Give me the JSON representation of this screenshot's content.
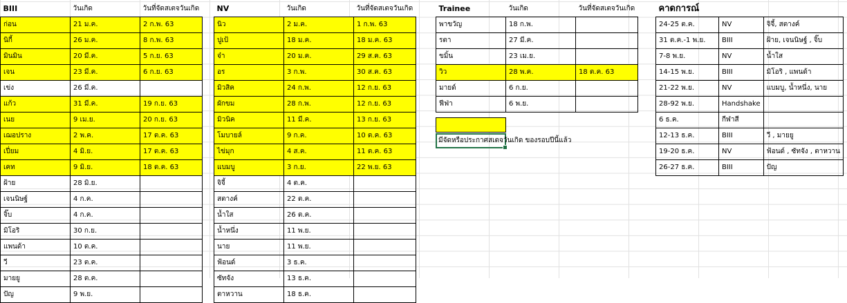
{
  "biii": {
    "headers": [
      "BIII",
      "วันเกิด",
      "วันที่จัดสเตจวันเกิด"
    ],
    "rows": [
      {
        "name": "ก่อน",
        "birthday": "21 ม.ค.",
        "stage": "2 ก.พ. 63",
        "highlight": true
      },
      {
        "name": "นิกี้",
        "birthday": "26 ม.ค.",
        "stage": "8 ก.พ. 63",
        "highlight": true
      },
      {
        "name": "มินมิน",
        "birthday": "20 มี.ค.",
        "stage": "5 ก.ย. 63",
        "highlight": true
      },
      {
        "name": "เจน",
        "birthday": "23 มี.ค.",
        "stage": "6 ก.ย. 63",
        "highlight": true
      },
      {
        "name": "เข่ง",
        "birthday": "26 มี.ค.",
        "stage": "",
        "highlight": false
      },
      {
        "name": "แก้ว",
        "birthday": "31 มี.ค.",
        "stage": "19 ก.ย. 63",
        "highlight": true
      },
      {
        "name": "เนย",
        "birthday": "9 เม.ย.",
        "stage": "20 ก.ย. 63",
        "highlight": true
      },
      {
        "name": "เฌอปราง",
        "birthday": "2 พ.ค.",
        "stage": "17 ต.ค. 63",
        "highlight": true
      },
      {
        "name": "เปี่ยม",
        "birthday": "4 มิ.ย.",
        "stage": "17 ต.ค. 63",
        "highlight": true
      },
      {
        "name": "เคท",
        "birthday": "9 มิ.ย.",
        "stage": "18 ต.ค. 63",
        "highlight": true
      },
      {
        "name": "ฝ้าย",
        "birthday": "28 มิ.ย.",
        "stage": "",
        "highlight": false
      },
      {
        "name": "เจนนิษฐ์",
        "birthday": "4 ก.ค.",
        "stage": "",
        "highlight": false
      },
      {
        "name": "จิ๊บ",
        "birthday": "4 ก.ค.",
        "stage": "",
        "highlight": false
      },
      {
        "name": "มิโอริ",
        "birthday": "30 ก.ย.",
        "stage": "",
        "highlight": false
      },
      {
        "name": "แพนด้า",
        "birthday": "10 ต.ค.",
        "stage": "",
        "highlight": false
      },
      {
        "name": "วี",
        "birthday": "23 ต.ค.",
        "stage": "",
        "highlight": false
      },
      {
        "name": "มายยู",
        "birthday": "28 ต.ค.",
        "stage": "",
        "highlight": false
      },
      {
        "name": "ปัญ",
        "birthday": "9 พ.ย.",
        "stage": "",
        "highlight": false
      }
    ]
  },
  "nv": {
    "headers": [
      "NV",
      "วันเกิด",
      "วันที่จัดสเตจวันเกิด"
    ],
    "rows": [
      {
        "name": "นิว",
        "birthday": "2 ม.ค.",
        "stage": "1 ก.พ. 63",
        "highlight": true
      },
      {
        "name": "ปูเป้",
        "birthday": "18 ม.ค.",
        "stage": "18 ม.ค. 63",
        "highlight": true
      },
      {
        "name": "จ๋า",
        "birthday": "20 ม.ค.",
        "stage": "29 ส.ค. 63",
        "highlight": true
      },
      {
        "name": "อร",
        "birthday": "3 ก.พ.",
        "stage": "30 ส.ค. 63",
        "highlight": true
      },
      {
        "name": "มิวสิค",
        "birthday": "24 ก.พ.",
        "stage": "12 ก.ย. 63",
        "highlight": true
      },
      {
        "name": "ผักขม",
        "birthday": "28 ก.พ.",
        "stage": "12 ก.ย. 63",
        "highlight": true
      },
      {
        "name": "มิวนิค",
        "birthday": "11 มี.ค.",
        "stage": "13 ก.ย. 63",
        "highlight": true
      },
      {
        "name": "โมบายล์",
        "birthday": "9 ก.ค.",
        "stage": "10 ต.ค. 63",
        "highlight": true
      },
      {
        "name": "ไข่มุก",
        "birthday": "4 ส.ค.",
        "stage": "11 ต.ค. 63",
        "highlight": true
      },
      {
        "name": "แบมบู",
        "birthday": "3 ก.ย.",
        "stage": "22 พ.ย. 63",
        "highlight": true
      },
      {
        "name": "จิจี้",
        "birthday": "4 ต.ค.",
        "stage": "",
        "highlight": false
      },
      {
        "name": "สตางค์",
        "birthday": "22 ต.ค.",
        "stage": "",
        "highlight": false
      },
      {
        "name": "น้ำใส",
        "birthday": "26 ต.ค.",
        "stage": "",
        "highlight": false
      },
      {
        "name": "น้ำหนึ่ง",
        "birthday": "11 พ.ย.",
        "stage": "",
        "highlight": false
      },
      {
        "name": "นาย",
        "birthday": "11 พ.ย.",
        "stage": "",
        "highlight": false
      },
      {
        "name": "ฟ้อนด์",
        "birthday": "3 ธ.ค.",
        "stage": "",
        "highlight": false
      },
      {
        "name": "ซัทจัง",
        "birthday": "13 ธ.ค.",
        "stage": "",
        "highlight": false
      },
      {
        "name": "ตาหวาน",
        "birthday": "18 ธ.ค.",
        "stage": "",
        "highlight": false
      }
    ]
  },
  "trainee": {
    "headers": [
      "Trainee",
      "วันเกิด",
      "วันที่จัดสเตจวันเกิด"
    ],
    "rows": [
      {
        "name": "พาขวัญ",
        "birthday": "18 ก.พ.",
        "stage": "",
        "highlight": false
      },
      {
        "name": "รตา",
        "birthday": "27 มี.ค.",
        "stage": "",
        "highlight": false
      },
      {
        "name": "ขมิ้น",
        "birthday": "23 เม.ย.",
        "stage": "",
        "highlight": false
      },
      {
        "name": "วิว",
        "birthday": "28 พ.ค.",
        "stage": "18 ต.ค. 63",
        "highlight": true
      },
      {
        "name": "มายด์",
        "birthday": "6 ก.ย.",
        "stage": "",
        "highlight": false
      },
      {
        "name": "ฟีฟ่า",
        "birthday": "6 พ.ย.",
        "stage": "",
        "highlight": false
      }
    ]
  },
  "legend": {
    "note": "มีจัดหรือประกาศสเตจวันเกิด ของรอบปีนี้แล้ว"
  },
  "forecast": {
    "title": "คาดการณ์",
    "rows": [
      {
        "dates": "24-25 ต.ค.",
        "team": "NV",
        "members": "จิจี้, สตางค์"
      },
      {
        "dates": "31 ต.ค.-1 พ.ย.",
        "team": "BIII",
        "members": "ฝ้าย, เจนนิษฐ์ , จิ๊บ"
      },
      {
        "dates": "7-8 พ.ย.",
        "team": "NV",
        "members": "น้ำใส"
      },
      {
        "dates": "14-15 พ.ย.",
        "team": "BIII",
        "members": "มิโอริ , แพนด้า"
      },
      {
        "dates": "21-22 พ.ย.",
        "team": "NV",
        "members": "แบมบู, น้ำหนึ่ง, นาย"
      },
      {
        "dates": "28-92 พ.ย.",
        "team": "Handshake",
        "members": ""
      },
      {
        "dates": "6 ธ.ค.",
        "team": "กีฬาสี",
        "members": ""
      },
      {
        "dates": "12-13 ธ.ค.",
        "team": "BIII",
        "members": "วี , มายยู"
      },
      {
        "dates": "19-20 ธ.ค.",
        "team": "NV",
        "members": "ฟ้อนด์ , ซัทจัง , ตาหวาน"
      },
      {
        "dates": "26-27 ธ.ค.",
        "team": "BIII",
        "members": "ปัญ"
      }
    ]
  },
  "colors": {
    "highlight": "#ffff00",
    "selection": "#217346"
  }
}
